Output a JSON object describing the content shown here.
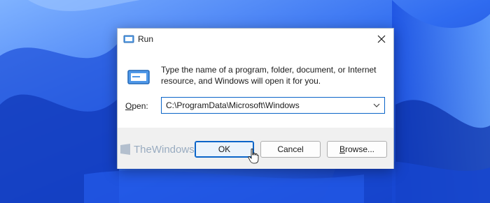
{
  "window": {
    "title": "Run",
    "app_icon": "run-icon"
  },
  "dialog": {
    "description": "Type the name of a program, folder, document, or Internet resource, and Windows will open it for you.",
    "open_label_accel": "O",
    "open_label_rest": "pen:",
    "open_value": "C:\\ProgramData\\Microsoft\\Windows"
  },
  "buttons": {
    "ok": "OK",
    "cancel": "Cancel",
    "browse_accel": "B",
    "browse_rest": "rowse..."
  },
  "watermark": "TheWindowsClub",
  "colors": {
    "accent": "#0a64c8",
    "wallpaper": "#2a63e6",
    "footer": "#f0f0f0"
  }
}
